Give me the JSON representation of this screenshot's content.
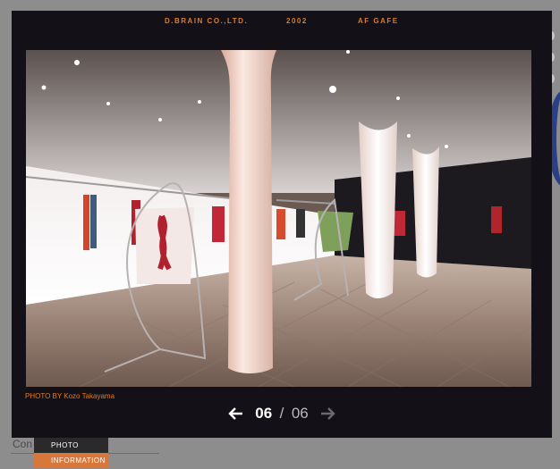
{
  "header": {
    "company": "D.BRAIN CO.,LTD.",
    "year": "2002",
    "project": "AF GAFE"
  },
  "photo": {
    "credit": "PHOTO BY Kozo Takayama"
  },
  "pager": {
    "current": "06",
    "separator": "/",
    "total": "06",
    "prev_icon": "arrow-left-icon",
    "next_icon": "arrow-right-icon"
  },
  "menu": {
    "items": [
      {
        "label": "PHOTO"
      },
      {
        "label": "INFORMATION"
      }
    ]
  },
  "background": {
    "text": "Con"
  },
  "colors": {
    "accent": "#e07b1c",
    "lightbox_bg": "#141018",
    "menu_active": "#d9773a"
  }
}
